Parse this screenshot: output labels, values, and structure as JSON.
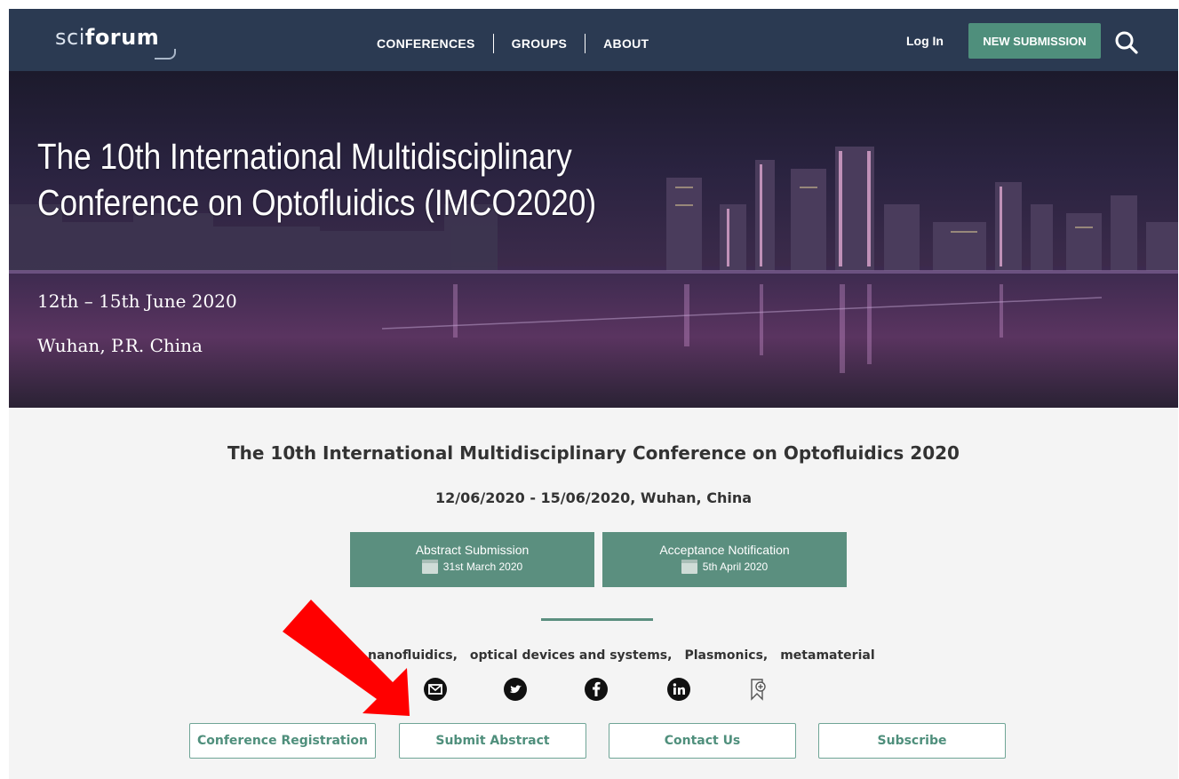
{
  "nav": {
    "logo_light": "sci",
    "logo_bold": "forum",
    "links": [
      "CONFERENCES",
      "GROUPS",
      "ABOUT"
    ],
    "login": "Log In",
    "new_submission": "NEW SUBMISSION",
    "search_icon": "search-icon"
  },
  "hero": {
    "title": "The 10th International Multidisciplinary Conference on Optofluidics (IMCO2020)",
    "date": "12th – 15th June 2020",
    "location": "Wuhan, P.R. China"
  },
  "main": {
    "title": "The 10th International Multidisciplinary Conference on Optofluidics 2020",
    "subtitle": "12/06/2020 - 15/06/2020, Wuhan, China",
    "deadlines": [
      {
        "label": "Abstract Submission",
        "date": "31st March 2020"
      },
      {
        "label": "Acceptance Notification",
        "date": "5th April 2020"
      }
    ],
    "keywords": [
      "nanofluidics,",
      "optical devices and systems,",
      "Plasmonics,",
      "metamaterial"
    ],
    "social_icons": [
      "email-icon",
      "twitter-icon",
      "facebook-icon",
      "linkedin-icon",
      "bookmark-add-icon"
    ],
    "buttons": [
      "Conference Registration",
      "Submit Abstract",
      "Contact Us",
      "Subscribe"
    ]
  },
  "colors": {
    "nav_bg": "#2b3a52",
    "accent_green": "#5b8f7f",
    "annotation_arrow": "#ff0000"
  }
}
